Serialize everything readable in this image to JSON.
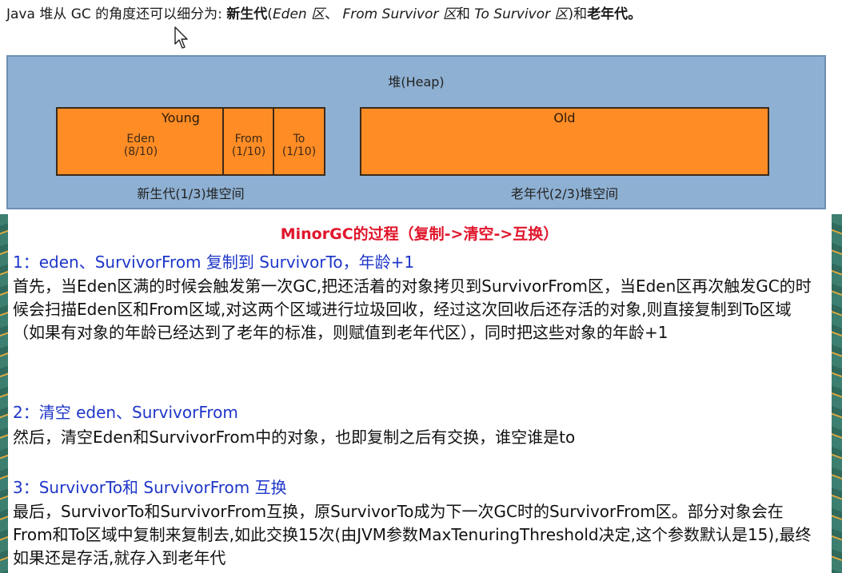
{
  "intro": {
    "prefix": "Java 堆从 GC 的角度还可以细分为: ",
    "bold1": "新生代",
    "paren_open": "(",
    "eden_it": "Eden 区",
    "sep1": "、 ",
    "from_it": "From Survivor 区",
    "and": "和 ",
    "to_it": "To Survivor 区",
    "paren_close": ")和",
    "bold2": "老年代",
    "end": "。"
  },
  "heap": {
    "title": "堆(Heap)",
    "young_title": "Young",
    "eden_name": "Eden",
    "eden_ratio": "(8/10)",
    "from_name": "From",
    "from_ratio": "(1/10)",
    "to_name": "To",
    "to_ratio": "(1/10)",
    "old_title": "Old",
    "young_caption": "新生代(1/3)堆空间",
    "old_caption": "老年代(2/3)堆空间"
  },
  "minor": {
    "title": "MinorGC的过程（复制->清空->互换）"
  },
  "steps": [
    {
      "heading": "1：eden、SurvivorFrom 复制到 SurvivorTo，年龄+1",
      "body": "首先，当Eden区满的时候会触发第一次GC,把还活着的对象拷贝到SurvivorFrom区，当Eden区再次触发GC的时候会扫描Eden区和From区域,对这两个区域进行垃圾回收，经过这次回收后还存活的对象,则直接复制到To区域（如果有对象的年龄已经达到了老年的标准，则赋值到老年代区），同时把这些对象的年龄+1"
    },
    {
      "heading": "2：清空 eden、SurvivorFrom",
      "body": "然后，清空Eden和SurvivorFrom中的对象，也即复制之后有交换，谁空谁是to"
    },
    {
      "heading": "3：SurvivorTo和 SurvivorFrom 互换",
      "body": "最后，SurvivorTo和SurvivorFrom互换，原SurvivorTo成为下一次GC时的SurvivorFrom区。部分对象会在From和To区域中复制来复制去,如此交换15次(由JVM参数MaxTenuringThreshold决定,这个参数默认是15),最终如果还是存活,就存入到老年代"
    }
  ],
  "colors": {
    "heap_bg": "#8eb0d2",
    "region_fill": "#ff8c24",
    "title_red": "#e0162b",
    "step_blue": "#1e36c8"
  },
  "icons": {
    "cursor": "mouse-pointer-icon"
  }
}
